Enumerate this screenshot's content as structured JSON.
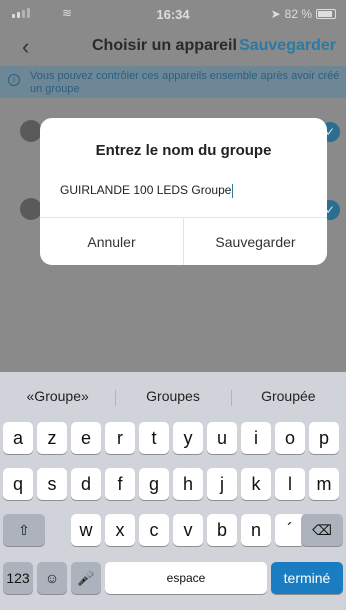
{
  "status": {
    "time": "16:34",
    "battery": "82 %"
  },
  "nav": {
    "back": "‹",
    "title": "Choisir un appareil",
    "save": "Sauvegarder"
  },
  "banner": {
    "icon": "info-icon",
    "text": "Vous pouvez contrôler ces appareils ensemble après avoir créé un groupe"
  },
  "dialog": {
    "title": "Entrez le nom du groupe",
    "value": "GUIRLANDE 100 LEDS Groupe",
    "cancel": "Annuler",
    "save": "Sauvegarder"
  },
  "keyboard": {
    "suggestions": [
      "«Groupe»",
      "Groupes",
      "Groupée"
    ],
    "row1": [
      "a",
      "z",
      "e",
      "r",
      "t",
      "y",
      "u",
      "i",
      "o",
      "p"
    ],
    "row2": [
      "q",
      "s",
      "d",
      "f",
      "g",
      "h",
      "j",
      "k",
      "l",
      "m"
    ],
    "row3": [
      "w",
      "x",
      "c",
      "v",
      "b",
      "n",
      "´"
    ],
    "numbers": "123",
    "space": "espace",
    "done": "terminé"
  }
}
